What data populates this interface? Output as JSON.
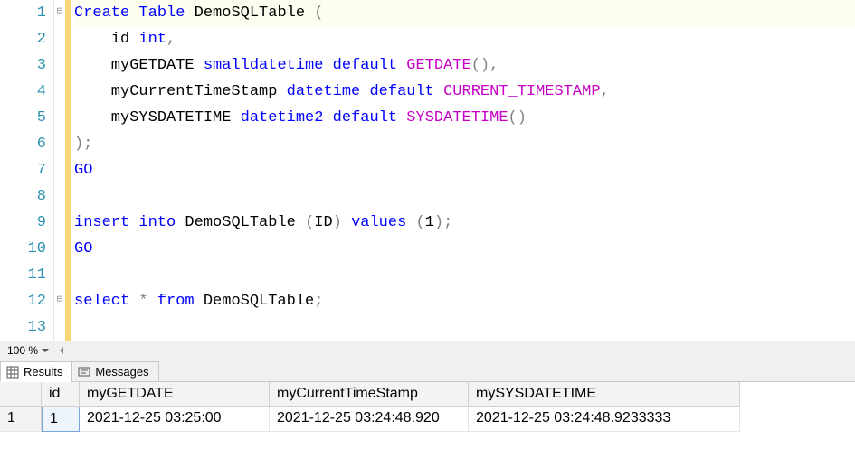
{
  "code": {
    "lines": [
      {
        "n": "1",
        "segs": [
          {
            "t": "Create",
            "c": "kw"
          },
          {
            "t": " ",
            "c": "plain"
          },
          {
            "t": "Table",
            "c": "kw"
          },
          {
            "t": " DemoSQLTable ",
            "c": "plain"
          },
          {
            "t": "(",
            "c": "gray"
          }
        ]
      },
      {
        "n": "2",
        "segs": [
          {
            "t": "    id ",
            "c": "plain"
          },
          {
            "t": "int",
            "c": "kw"
          },
          {
            "t": ",",
            "c": "gray"
          }
        ]
      },
      {
        "n": "3",
        "segs": [
          {
            "t": "    myGETDATE ",
            "c": "plain"
          },
          {
            "t": "smalldatetime",
            "c": "kw"
          },
          {
            "t": " ",
            "c": "plain"
          },
          {
            "t": "default",
            "c": "kw"
          },
          {
            "t": " ",
            "c": "plain"
          },
          {
            "t": "GETDATE",
            "c": "func"
          },
          {
            "t": "(),",
            "c": "gray"
          }
        ]
      },
      {
        "n": "4",
        "segs": [
          {
            "t": "    myCurrentTimeStamp ",
            "c": "plain"
          },
          {
            "t": "datetime",
            "c": "kw"
          },
          {
            "t": " ",
            "c": "plain"
          },
          {
            "t": "default",
            "c": "kw"
          },
          {
            "t": " ",
            "c": "plain"
          },
          {
            "t": "CURRENT_TIMESTAMP",
            "c": "func"
          },
          {
            "t": ",",
            "c": "gray"
          }
        ]
      },
      {
        "n": "5",
        "segs": [
          {
            "t": "    mySYSDATETIME ",
            "c": "plain"
          },
          {
            "t": "datetime2",
            "c": "kw"
          },
          {
            "t": " ",
            "c": "plain"
          },
          {
            "t": "default",
            "c": "kw"
          },
          {
            "t": " ",
            "c": "plain"
          },
          {
            "t": "SYSDATETIME",
            "c": "func"
          },
          {
            "t": "()",
            "c": "gray"
          }
        ]
      },
      {
        "n": "6",
        "segs": [
          {
            "t": ");",
            "c": "gray"
          }
        ]
      },
      {
        "n": "7",
        "segs": [
          {
            "t": "GO",
            "c": "kw"
          }
        ]
      },
      {
        "n": "8",
        "segs": [
          {
            "t": " ",
            "c": "plain"
          }
        ]
      },
      {
        "n": "9",
        "segs": [
          {
            "t": "insert",
            "c": "kw"
          },
          {
            "t": " ",
            "c": "plain"
          },
          {
            "t": "into",
            "c": "kw"
          },
          {
            "t": " DemoSQLTable ",
            "c": "plain"
          },
          {
            "t": "(",
            "c": "gray"
          },
          {
            "t": "ID",
            "c": "plain"
          },
          {
            "t": ")",
            "c": "gray"
          },
          {
            "t": " ",
            "c": "plain"
          },
          {
            "t": "values",
            "c": "kw"
          },
          {
            "t": " ",
            "c": "plain"
          },
          {
            "t": "(",
            "c": "gray"
          },
          {
            "t": "1",
            "c": "plain"
          },
          {
            "t": ");",
            "c": "gray"
          }
        ]
      },
      {
        "n": "10",
        "segs": [
          {
            "t": "GO",
            "c": "kw"
          }
        ]
      },
      {
        "n": "11",
        "segs": [
          {
            "t": " ",
            "c": "plain"
          }
        ]
      },
      {
        "n": "12",
        "segs": [
          {
            "t": "select",
            "c": "kw"
          },
          {
            "t": " ",
            "c": "plain"
          },
          {
            "t": "*",
            "c": "gray"
          },
          {
            "t": " ",
            "c": "plain"
          },
          {
            "t": "from",
            "c": "kw"
          },
          {
            "t": " DemoSQLTable",
            "c": "plain"
          },
          {
            "t": ";",
            "c": "gray"
          }
        ]
      },
      {
        "n": "13",
        "segs": [
          {
            "t": " ",
            "c": "plain"
          }
        ]
      }
    ]
  },
  "zoom": "100 %",
  "tabs": {
    "results": "Results",
    "messages": "Messages"
  },
  "results": {
    "headers": [
      "id",
      "myGETDATE",
      "myCurrentTimeStamp",
      "mySYSDATETIME"
    ],
    "rownum": "1",
    "row": [
      "1",
      "2021-12-25 03:25:00",
      "2021-12-25 03:24:48.920",
      "2021-12-25 03:24:48.9233333"
    ]
  }
}
